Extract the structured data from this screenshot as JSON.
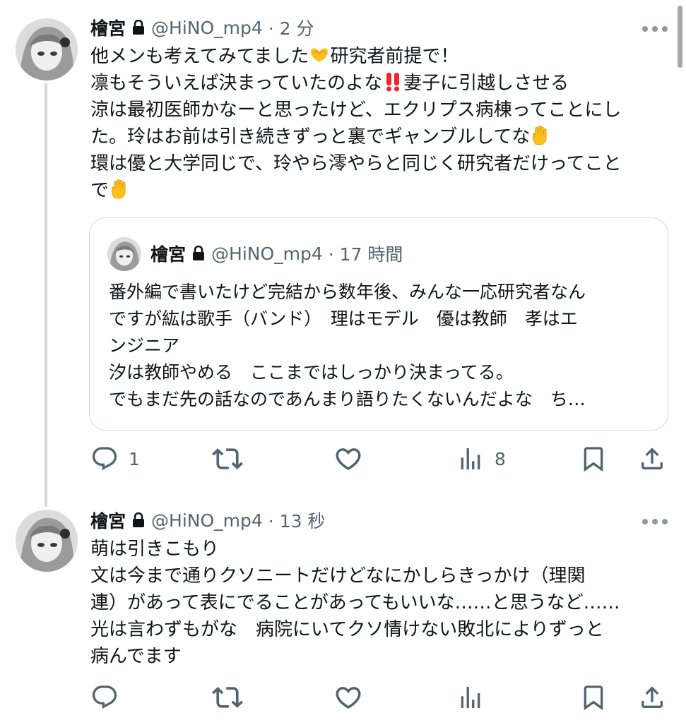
{
  "tweets": [
    {
      "display_name": "檜宮",
      "handle": "@HiNO_mp4",
      "time": "· 2 分",
      "lines": [
        "他メンも考えてみてました",
        "研究者前提で！",
        "凛もそういえば決まっていたのよな",
        "妻子に引越しさせる",
        "涼は最初医師かなーと思ったけど、エクリプス病棟ってことにし",
        "た。玲はお前は引き続きずっと裏でギャンブルしてな",
        "環は優と大学同じで、玲やら澪やらと同じく研究者だけってこと",
        "で"
      ],
      "emojis": [
        "heart-hands-emoji",
        "double-exclamation-emoji",
        "raised-hand-emoji",
        "raised-hand-emoji"
      ],
      "quote": {
        "display_name": "檜宮",
        "handle": "@HiNO_mp4",
        "time": "· 17 時間",
        "lines": [
          "番外編で書いたけど完結から数年後、みんな一応研究者なん",
          "ですが紘は歌手（バンド）　理はモデル　優は教師　孝はエ",
          "ンジニア",
          "汐は教師やめる　ここまではしっかり決まってる。",
          "でもまだ先の話なのであんまり語りたくないんだよな　ち…"
        ]
      },
      "actions": {
        "replies": "1",
        "retweets": "",
        "likes": "",
        "views": "8"
      }
    },
    {
      "display_name": "檜宮",
      "handle": "@HiNO_mp4",
      "time": "· 13 秒",
      "lines": [
        "萌は引きこもり",
        "文は今まで通りクソニートだけどなにかしらきっかけ（理関",
        "連）があって表にでることがあってもいいな……と思うなど……",
        "光は言わずもがな　病院にいてクソ情けない敗北によりずっと",
        "病んでます"
      ],
      "actions": {
        "replies": "",
        "retweets": "",
        "likes": "",
        "views": ""
      }
    }
  ],
  "colors": {
    "text": "#0f1419",
    "muted": "#536471",
    "thread_line": "#cfd9de",
    "border": "#cfd9de"
  }
}
